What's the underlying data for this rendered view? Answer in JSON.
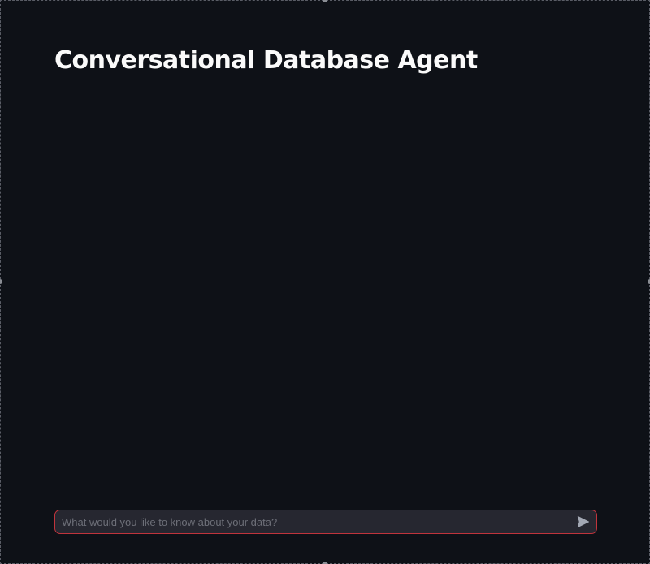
{
  "main": {
    "title": "Conversational Database Agent"
  },
  "chat_input": {
    "placeholder": "What would you like to know about your data?",
    "value": "",
    "send_icon": "send-icon"
  },
  "colors": {
    "background": "#0e1117",
    "input_background": "#262730",
    "input_border": "#c0343c",
    "title_text": "#fafafa",
    "placeholder_text": "#6d6f78",
    "icon": "#a3a8b4"
  }
}
